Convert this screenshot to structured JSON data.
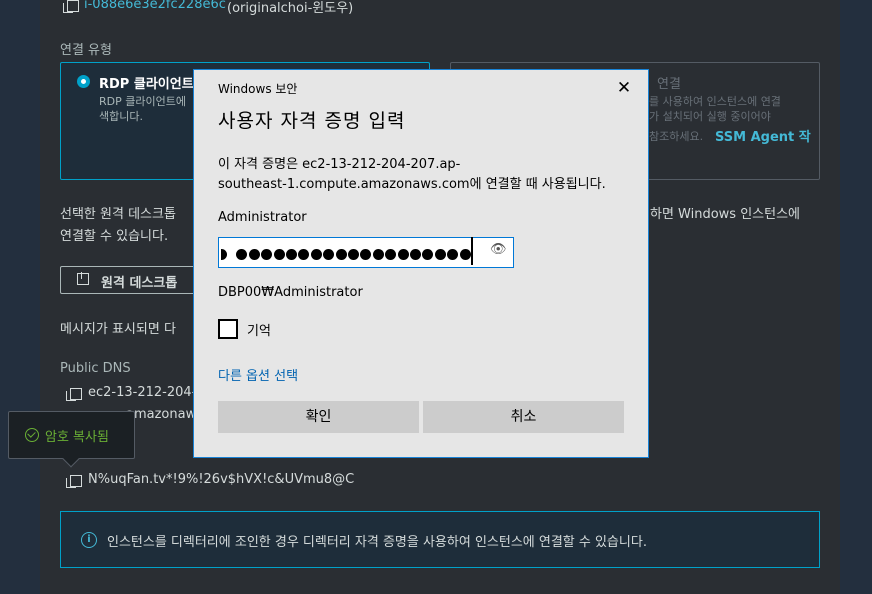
{
  "instance": {
    "id": "i-088e6e3e2fc228e6c",
    "name": "(originalchoi-윈도우)"
  },
  "connection_type": {
    "label": "연결 유형",
    "rdp_title": "RDP 클라이언트",
    "rdp_desc_line1": "RDP 클라이언트에",
    "rdp_desc_line2": "색합니다.",
    "fleet_title": "연결",
    "fleet_desc_line1": "를 사용하여 인스턴스에 연결",
    "fleet_desc_line2": "가 설치되어 실행 중이어야",
    "fleet_desc_line3": "참조하세요.",
    "fleet_link": "SSM Agent 작"
  },
  "desc": {
    "line1_left": "선택한 원격 데스크톱",
    "line1_right": "하면 Windows 인스턴스에",
    "line2": "연결할 수 있습니다."
  },
  "download_button": "원격 데스크톱",
  "message_prompt": "메시지가 표시되면 다",
  "public_dns": {
    "label": "Public DNS",
    "value_line1": "ec2-13-212-204-",
    "value_line2": "amazonaw"
  },
  "password": {
    "value": "N%uqFan.tv*!9%!26v$hVX!c&UVmu8@C"
  },
  "toast": {
    "text": "암호 복사됨"
  },
  "info_banner": "인스턴스를 디렉터리에 조인한 경우 디렉터리 자격 증명을 사용하여 인스턴스에 연결할 수 있습니다.",
  "dialog": {
    "window_title": "Windows 보안",
    "heading": "사용자 자격 증명 입력",
    "message_line1": "이 자격 증명은 ec2-13-212-204-207.ap-",
    "message_line2": "southeast-1.compute.amazonaws.com에 연결할 때 사용됩니다.",
    "username": "Administrator",
    "domain_user": "DBP00₩Administrator",
    "remember_label": "기억",
    "other_options": "다른 옵션 선택",
    "ok": "확인",
    "cancel": "취소",
    "password_dot_count": 20
  },
  "colors": {
    "page_bg": "#232f3e",
    "panel_bg": "#2a2e33",
    "accent": "#00a1c9",
    "link": "#44b9d6",
    "dialog_bg": "#e6e6e6",
    "dialog_border": "#1883d7",
    "success": "#6aaf35"
  }
}
